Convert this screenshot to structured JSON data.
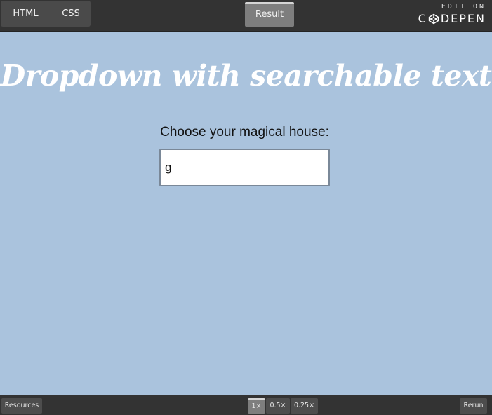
{
  "topbar": {
    "tabs": [
      "HTML",
      "CSS"
    ],
    "result_label": "Result",
    "brand": {
      "edit_on": "EDIT ON",
      "logo_left": "C",
      "logo_right": "DEPEN"
    }
  },
  "main": {
    "title": "Dropdown with searchable text",
    "label": "Choose your magical house:",
    "input_value": "g"
  },
  "bottombar": {
    "resources": "Resources",
    "zoom_options": [
      "1×",
      "0.5×",
      "0.25×"
    ],
    "rerun": "Rerun"
  },
  "colors": {
    "background": "#aac3dd",
    "bar": "#333333",
    "tab": "#4a4a4a",
    "tab_active": "#7e7e7e",
    "title": "#ffffff"
  }
}
